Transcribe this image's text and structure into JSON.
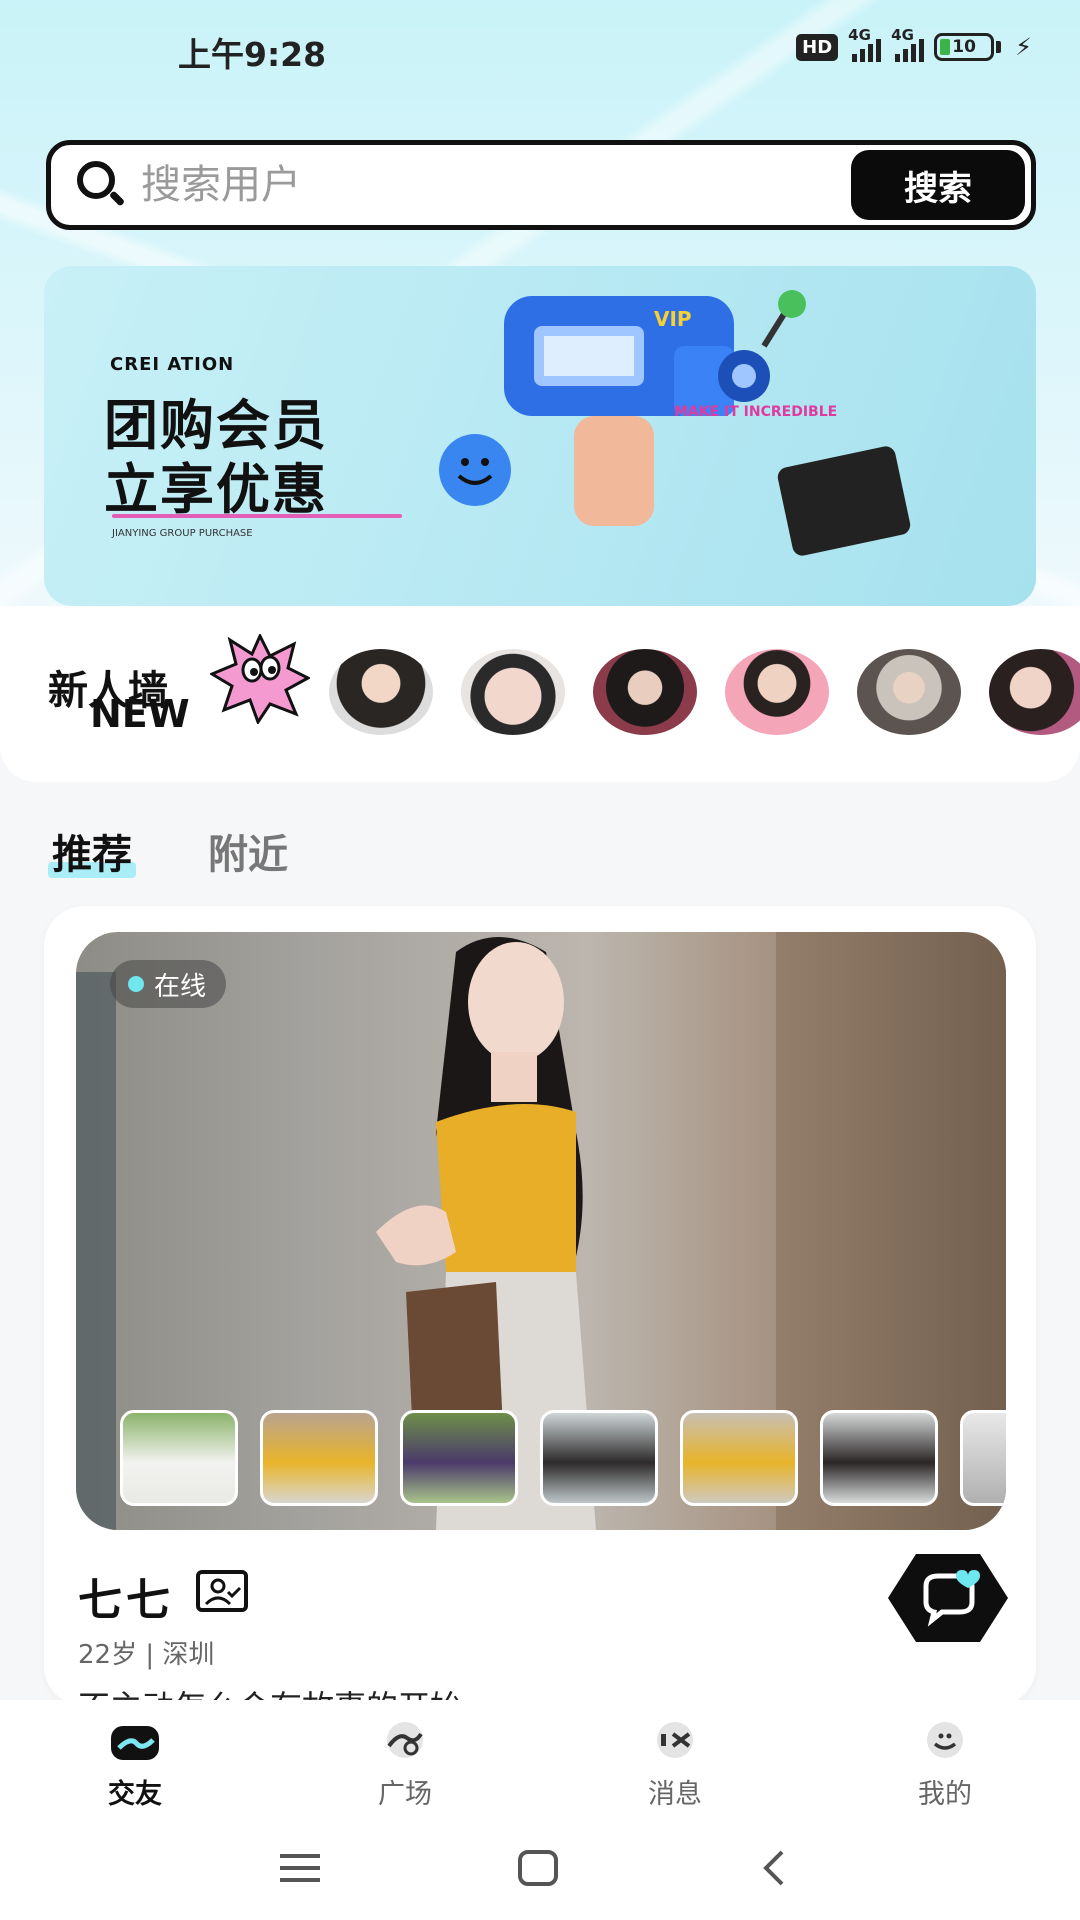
{
  "status_bar": {
    "time": "上午9:28",
    "hd_label": "HD",
    "network_1": "4G",
    "network_2": "4G",
    "battery_level": "10"
  },
  "search": {
    "placeholder": "搜索用户",
    "button_label": "搜索"
  },
  "banner": {
    "tag": "CREI ATION",
    "title_line1": "团购会员",
    "title_line2": "立享优惠",
    "subtitle": "JIANYING GROUP PURCHASE",
    "gun_label": "MAKE IT INCREDIBLE",
    "vip_label": "VIP"
  },
  "new_wall": {
    "label_cn": "新人墙",
    "label_en": "NEW",
    "avatar_count": 6
  },
  "tabs": [
    {
      "label": "推荐",
      "active": true
    },
    {
      "label": "附近",
      "active": false
    }
  ],
  "profile": {
    "status": "在线",
    "name": "七七",
    "age_city": "22岁 | 深圳",
    "bio": "不主动怎么会有故事的开始"
  },
  "bottom_nav": [
    {
      "label": "交友",
      "icon": "friends-icon",
      "active": true
    },
    {
      "label": "广场",
      "icon": "plaza-icon",
      "active": false
    },
    {
      "label": "消息",
      "icon": "message-icon",
      "active": false
    },
    {
      "label": "我的",
      "icon": "profile-icon",
      "active": false
    }
  ],
  "colors": {
    "accent": "#a9eef6",
    "dark": "#0b0b0b",
    "online": "#6ee7ef"
  }
}
